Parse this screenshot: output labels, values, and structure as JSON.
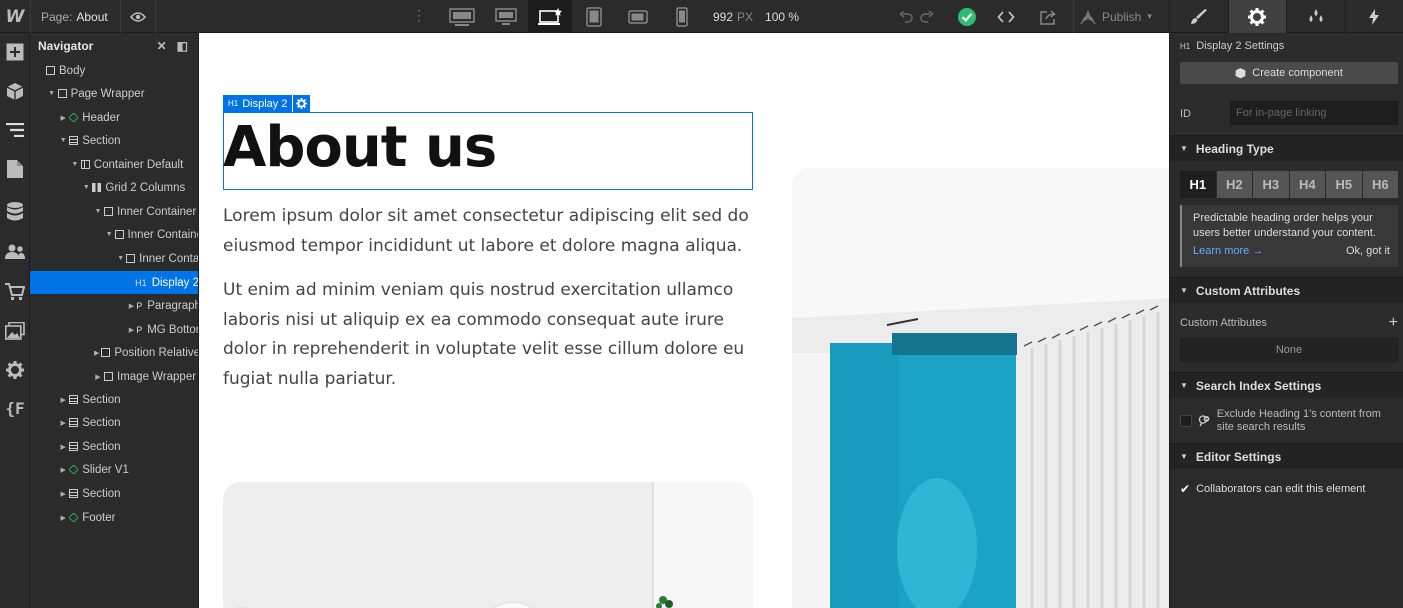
{
  "topbar": {
    "logo": "W",
    "page_prefix": "Page:",
    "page_name": "About",
    "width_value": "992",
    "width_unit": "PX",
    "zoom": "100 %",
    "publish_label": "Publish"
  },
  "navigator": {
    "title": "Navigator",
    "tree": [
      {
        "label": "Body",
        "indent": 0,
        "icon": "body",
        "caret": ""
      },
      {
        "label": "Page Wrapper",
        "indent": 1,
        "icon": "box",
        "caret": "open"
      },
      {
        "label": "Header",
        "indent": 2,
        "icon": "component",
        "caret": "closed"
      },
      {
        "label": "Section",
        "indent": 2,
        "icon": "section",
        "caret": "open"
      },
      {
        "label": "Container Default",
        "indent": 3,
        "icon": "container",
        "caret": "open"
      },
      {
        "label": "Grid 2 Columns",
        "indent": 4,
        "icon": "grid",
        "caret": "open"
      },
      {
        "label": "Inner Container",
        "indent": 5,
        "icon": "box",
        "caret": "open"
      },
      {
        "label": "Inner Containe",
        "indent": 6,
        "icon": "box",
        "caret": "open"
      },
      {
        "label": "Inner Contai",
        "indent": 7,
        "icon": "box",
        "caret": "open"
      },
      {
        "label": "Display 2",
        "indent": 8,
        "icon": "H1",
        "caret": "",
        "selected": true
      },
      {
        "label": "Paragraph",
        "indent": 8,
        "icon": "P",
        "caret": "closed"
      },
      {
        "label": "MG Bottom",
        "indent": 8,
        "icon": "P",
        "caret": "closed"
      },
      {
        "label": "Position Relative",
        "indent": 5,
        "icon": "box",
        "caret": "closed"
      },
      {
        "label": "Image Wrapper",
        "indent": 5,
        "icon": "box",
        "caret": "closed"
      },
      {
        "label": "Section",
        "indent": 2,
        "icon": "section",
        "caret": "closed"
      },
      {
        "label": "Section",
        "indent": 2,
        "icon": "section",
        "caret": "closed"
      },
      {
        "label": "Section",
        "indent": 2,
        "icon": "section",
        "caret": "closed"
      },
      {
        "label": "Slider V1",
        "indent": 2,
        "icon": "component",
        "caret": "closed"
      },
      {
        "label": "Section",
        "indent": 2,
        "icon": "section",
        "caret": "closed"
      },
      {
        "label": "Footer",
        "indent": 2,
        "icon": "component",
        "caret": "closed"
      }
    ]
  },
  "canvas": {
    "badge_tag": "H1",
    "badge_label": "Display 2",
    "heading": "About us",
    "paragraph1": "Lorem ipsum dolor sit amet consectetur adipiscing elit sed do eiusmod tempor incididunt ut labore et dolore magna aliqua.",
    "paragraph2": "Ut enim ad minim veniam quis nostrud exercitation ullamco laboris nisi ut aliquip ex ea commodo consequat aute irure dolor in reprehenderit in voluptate velit esse cillum dolore eu fugiat nulla pariatur."
  },
  "settings": {
    "title_tag": "H1",
    "title": "Display 2 Settings",
    "create_component": "Create component",
    "id_label": "ID",
    "id_placeholder": "For in-page linking",
    "heading_type_title": "Heading Type",
    "heading_levels": [
      "H1",
      "H2",
      "H3",
      "H4",
      "H5",
      "H6"
    ],
    "active_level": "H1",
    "tip_text": "Predictable heading order helps your users better understand your content.",
    "tip_learn": "Learn more →",
    "tip_ok": "Ok, got it",
    "custom_attr_title": "Custom Attributes",
    "custom_attr_label": "Custom Attributes",
    "custom_attr_add": "+",
    "custom_attr_empty": "None",
    "search_index_title": "Search Index Settings",
    "search_exclude_text": "Exclude Heading 1's content from site search results",
    "search_exclude_checked": false,
    "editor_settings_title": "Editor Settings",
    "collab_text": "Collaborators can edit this element",
    "collab_checked": true
  },
  "colors": {
    "accent": "#0073e6",
    "success": "#2dbd6e",
    "panel": "#2b2b2b",
    "image_blue": "#1ba3c6"
  }
}
